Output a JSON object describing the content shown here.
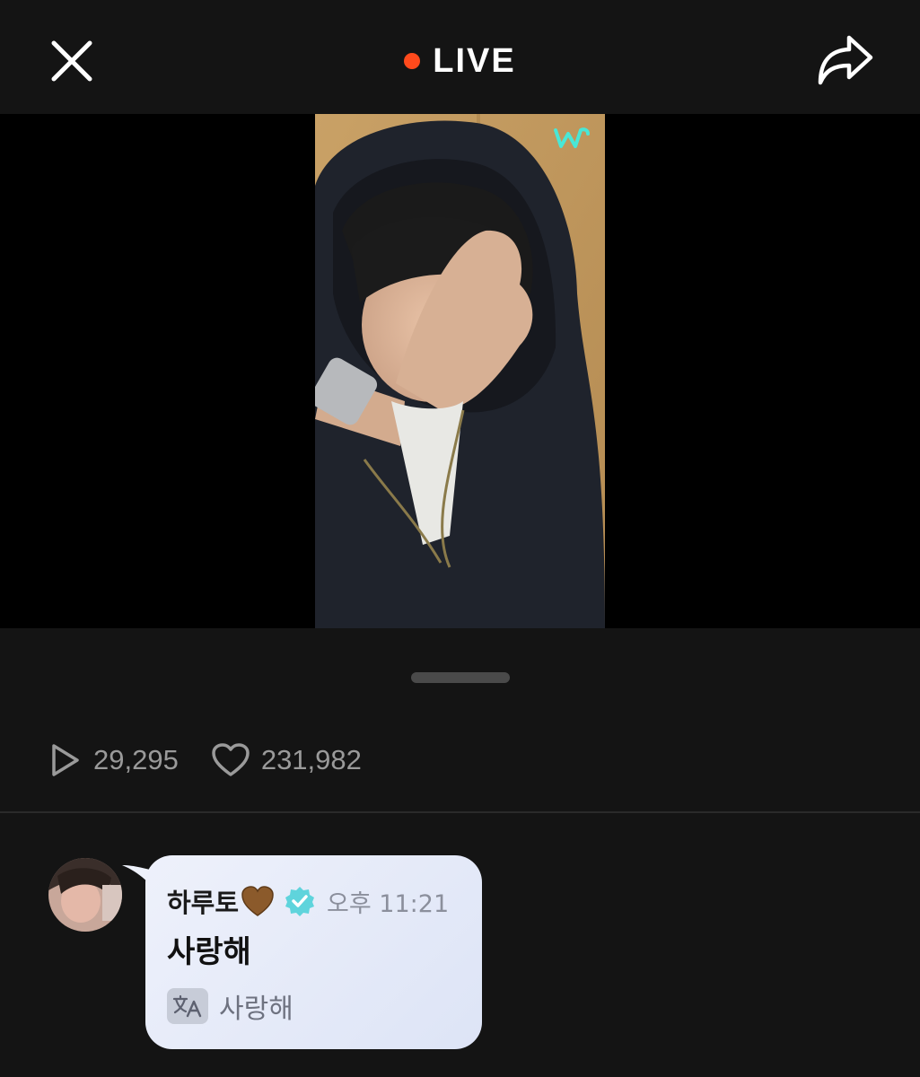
{
  "header": {
    "close_icon": "close-icon",
    "live_label": "LIVE",
    "live_dot_color": "#ff4a1c",
    "share_icon": "share-icon"
  },
  "video": {
    "brand_icon": "weverse-logo-icon"
  },
  "stats": {
    "plays": "29,295",
    "likes": "231,982",
    "play_icon": "play-icon",
    "like_icon": "heart-icon"
  },
  "comment": {
    "author": "하루토",
    "author_emoji": "brown-heart-icon",
    "verified_icon": "verified-badge-icon",
    "verified_color": "#5fd4dc",
    "time": "오후 11:21",
    "message": "사랑해",
    "translate_icon": "translate-icon",
    "translated_message": "사랑해"
  }
}
